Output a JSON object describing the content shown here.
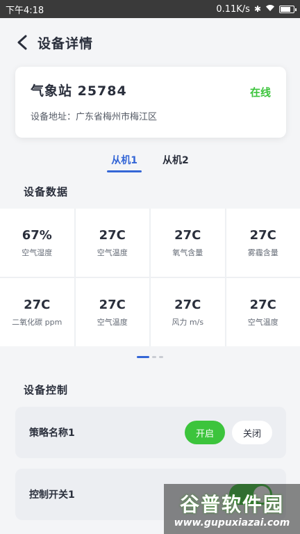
{
  "status_bar": {
    "time": "下午4:18",
    "network_speed": "0.11K/s"
  },
  "header": {
    "title": "设备详情"
  },
  "device": {
    "name": "气象站 25784",
    "status": "在线",
    "address": "设备地址：广东省梅州市梅江区"
  },
  "tabs": [
    {
      "label": "从机1",
      "active": true
    },
    {
      "label": "从机2",
      "active": false
    }
  ],
  "sections": {
    "data_title": "设备数据",
    "control_title": "设备控制"
  },
  "data_cells": [
    {
      "value": "67%",
      "label": "空气湿度"
    },
    {
      "value": "27C",
      "label": "空气温度"
    },
    {
      "value": "27C",
      "label": "氧气含量"
    },
    {
      "value": "27C",
      "label": "雾霾含量"
    },
    {
      "value": "27C",
      "label": "二氧化碳 ppm"
    },
    {
      "value": "27C",
      "label": "空气温度"
    },
    {
      "value": "27C",
      "label": "风力 m/s"
    },
    {
      "value": "27C",
      "label": "空气温度"
    }
  ],
  "pager": {
    "page_count": 3,
    "current": 1
  },
  "controls": [
    {
      "label": "策略名称1",
      "on_label": "开启",
      "off_label": "关闭"
    },
    {
      "label": "控制开关1",
      "toggle_on": true
    }
  ],
  "watermark": {
    "title": "谷普软件园",
    "url": "www.gupuxiazai.com"
  },
  "colors": {
    "accent": "#3466d6",
    "online_green": "#3cc43c"
  }
}
